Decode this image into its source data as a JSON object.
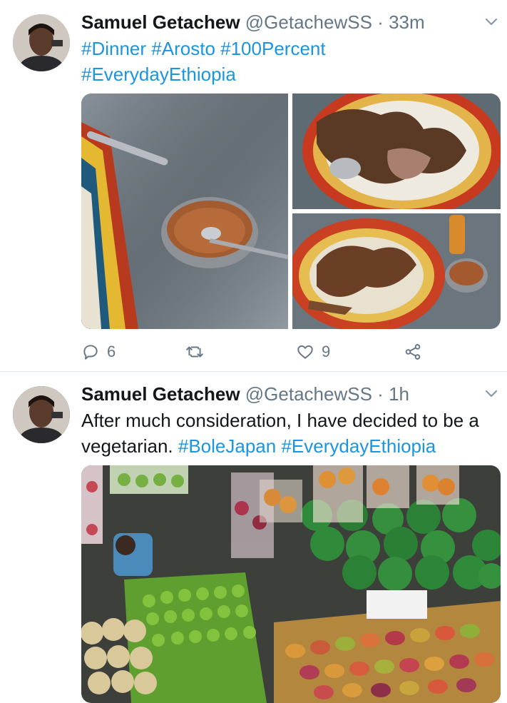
{
  "tweets": [
    {
      "author_name": "Samuel Getachew",
      "handle": "@GetachewSS",
      "separator": "·",
      "time": "33m",
      "text_parts": [
        {
          "text": "#Dinner",
          "type": "hashtag"
        },
        {
          "text": " ",
          "type": "plain"
        },
        {
          "text": "#Arosto",
          "type": "hashtag"
        },
        {
          "text": " ",
          "type": "plain"
        },
        {
          "text": "#100Percent",
          "type": "hashtag"
        },
        {
          "text": " ",
          "type": "plain"
        },
        {
          "text": "#EverydayEthiopia",
          "type": "hashtag"
        }
      ],
      "replies": "6",
      "retweets": "",
      "likes": "9"
    },
    {
      "author_name": "Samuel Getachew",
      "handle": "@GetachewSS",
      "separator": "·",
      "time": "1h",
      "text_parts": [
        {
          "text": "After much consideration, I have decided to be a vegetarian. ",
          "type": "plain"
        },
        {
          "text": "#BoleJapan",
          "type": "hashtag"
        },
        {
          "text": " ",
          "type": "plain"
        },
        {
          "text": "#EverydayEthiopia",
          "type": "hashtag"
        }
      ]
    }
  ],
  "colors": {
    "hashtag": "#1b95e0",
    "secondary_text": "#657786",
    "divider": "#e1e8ed"
  },
  "icons": [
    "reply-icon",
    "retweet-icon",
    "like-icon",
    "share-icon",
    "chevron-down-icon"
  ]
}
